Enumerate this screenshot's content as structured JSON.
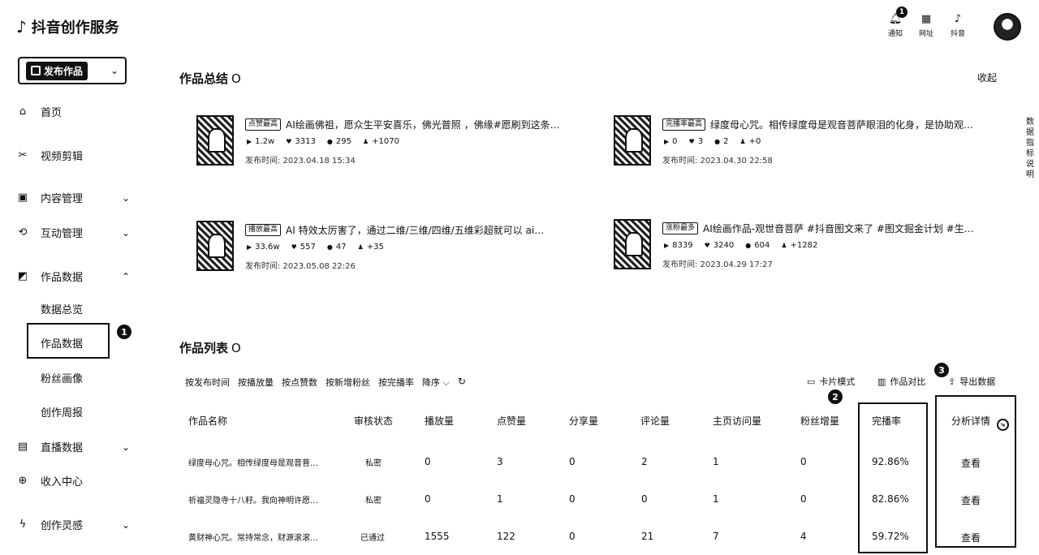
{
  "app": {
    "logo_icon": "tiktok-icon",
    "title": "抖音创作服务",
    "publish_label": "发布作品"
  },
  "sidebar": {
    "items": [
      {
        "label": "首页",
        "icon": "home-icon",
        "glyph": "⌂",
        "chevron": ""
      },
      {
        "label": "视频剪辑",
        "icon": "scissors-icon",
        "glyph": "✂",
        "chevron": ""
      },
      {
        "label": "内容管理",
        "icon": "content-icon",
        "glyph": "▣",
        "chevron": "⌄"
      },
      {
        "label": "互动管理",
        "icon": "interaction-icon",
        "glyph": "⟲",
        "chevron": "⌄"
      },
      {
        "label": "作品数据",
        "icon": "chart-icon",
        "glyph": "◩",
        "chevron": "⌃"
      },
      {
        "label": "直播数据",
        "icon": "live-icon",
        "glyph": "▤",
        "chevron": "⌄"
      },
      {
        "label": "收入中心",
        "icon": "income-icon",
        "glyph": "⊕",
        "chevron": ""
      },
      {
        "label": "创作灵感",
        "icon": "inspiration-icon",
        "glyph": "ϟ",
        "chevron": "⌄"
      }
    ],
    "sub_items": [
      "数据总览",
      "作品数据",
      "粉丝画像",
      "创作周报"
    ]
  },
  "header": {
    "notify": {
      "label": "通知",
      "badge": "1"
    },
    "site": {
      "label": "网址"
    },
    "douyin": {
      "label": "抖音"
    }
  },
  "summary": {
    "title": "作品总结",
    "info_glyph": "O",
    "collapse_label": "收起",
    "side_note": "数据指标说明",
    "cards": [
      {
        "tag": "点赞最高",
        "title": "AI绘画佛祖，愿众生平安喜乐，佛光普照 ，佛缘#愿刷到这条…",
        "plays": "1.2w",
        "likes": "3313",
        "comments": "295",
        "fans": "+1070",
        "time": "发布时间: 2023.04.18 15:34"
      },
      {
        "tag": "完播率最高",
        "title": "绿度母心咒。相传绿度母是观音菩萨眼泪的化身，是协助观…",
        "plays": "0",
        "likes": "3",
        "comments": "2",
        "fans": "+0",
        "time": "发布时间: 2023.04.30 22:58"
      },
      {
        "tag": "播放最高",
        "title": "AI 特效太厉害了，通过二维/三维/四维/五维彩超就可以 ai…",
        "plays": "33.6w",
        "likes": "557",
        "comments": "47",
        "fans": "+35",
        "time": "发布时间: 2023.05.08 22:26"
      },
      {
        "tag": "涨粉最多",
        "title": "AI绘画作品-观世音菩萨 #抖音图文来了 #图文掘金计划 #生…",
        "plays": "8339",
        "likes": "3240",
        "comments": "604",
        "fans": "+1282",
        "time": "发布时间: 2023.04.29 17:27"
      }
    ]
  },
  "works": {
    "title": "作品列表",
    "info_glyph": "O",
    "filters": [
      "按发布时间",
      "按播放量",
      "按点赞数",
      "按新增粉丝",
      "按完播率"
    ],
    "sort_label": "降序",
    "card_mode": "卡片模式",
    "compare": "作品对比",
    "export": "导出数据",
    "columns": [
      "作品名称",
      "审核状态",
      "播放量",
      "点赞量",
      "分享量",
      "评论量",
      "主页访问量",
      "粉丝增量",
      "完播率",
      "分析详情"
    ],
    "rows": [
      {
        "name": "绿度母心咒。相传绿度母是观音菩…",
        "status": "私密",
        "plays": "0",
        "likes": "3",
        "shares": "0",
        "comments": "2",
        "visits": "1",
        "fans": "0",
        "completion": "92.86%",
        "action": "查看"
      },
      {
        "name": "祈福灵隐寺十八籽。我向神明许愿…",
        "status": "私密",
        "plays": "0",
        "likes": "1",
        "shares": "0",
        "comments": "0",
        "visits": "1",
        "fans": "0",
        "completion": "82.86%",
        "action": "查看"
      },
      {
        "name": "黄财神心咒。常持常念，财源滚滚…",
        "status": "已通过",
        "plays": "1555",
        "likes": "122",
        "shares": "0",
        "comments": "21",
        "visits": "7",
        "fans": "4",
        "completion": "59.72%",
        "action": "查看"
      }
    ]
  },
  "annotations": [
    "1",
    "2",
    "3"
  ]
}
